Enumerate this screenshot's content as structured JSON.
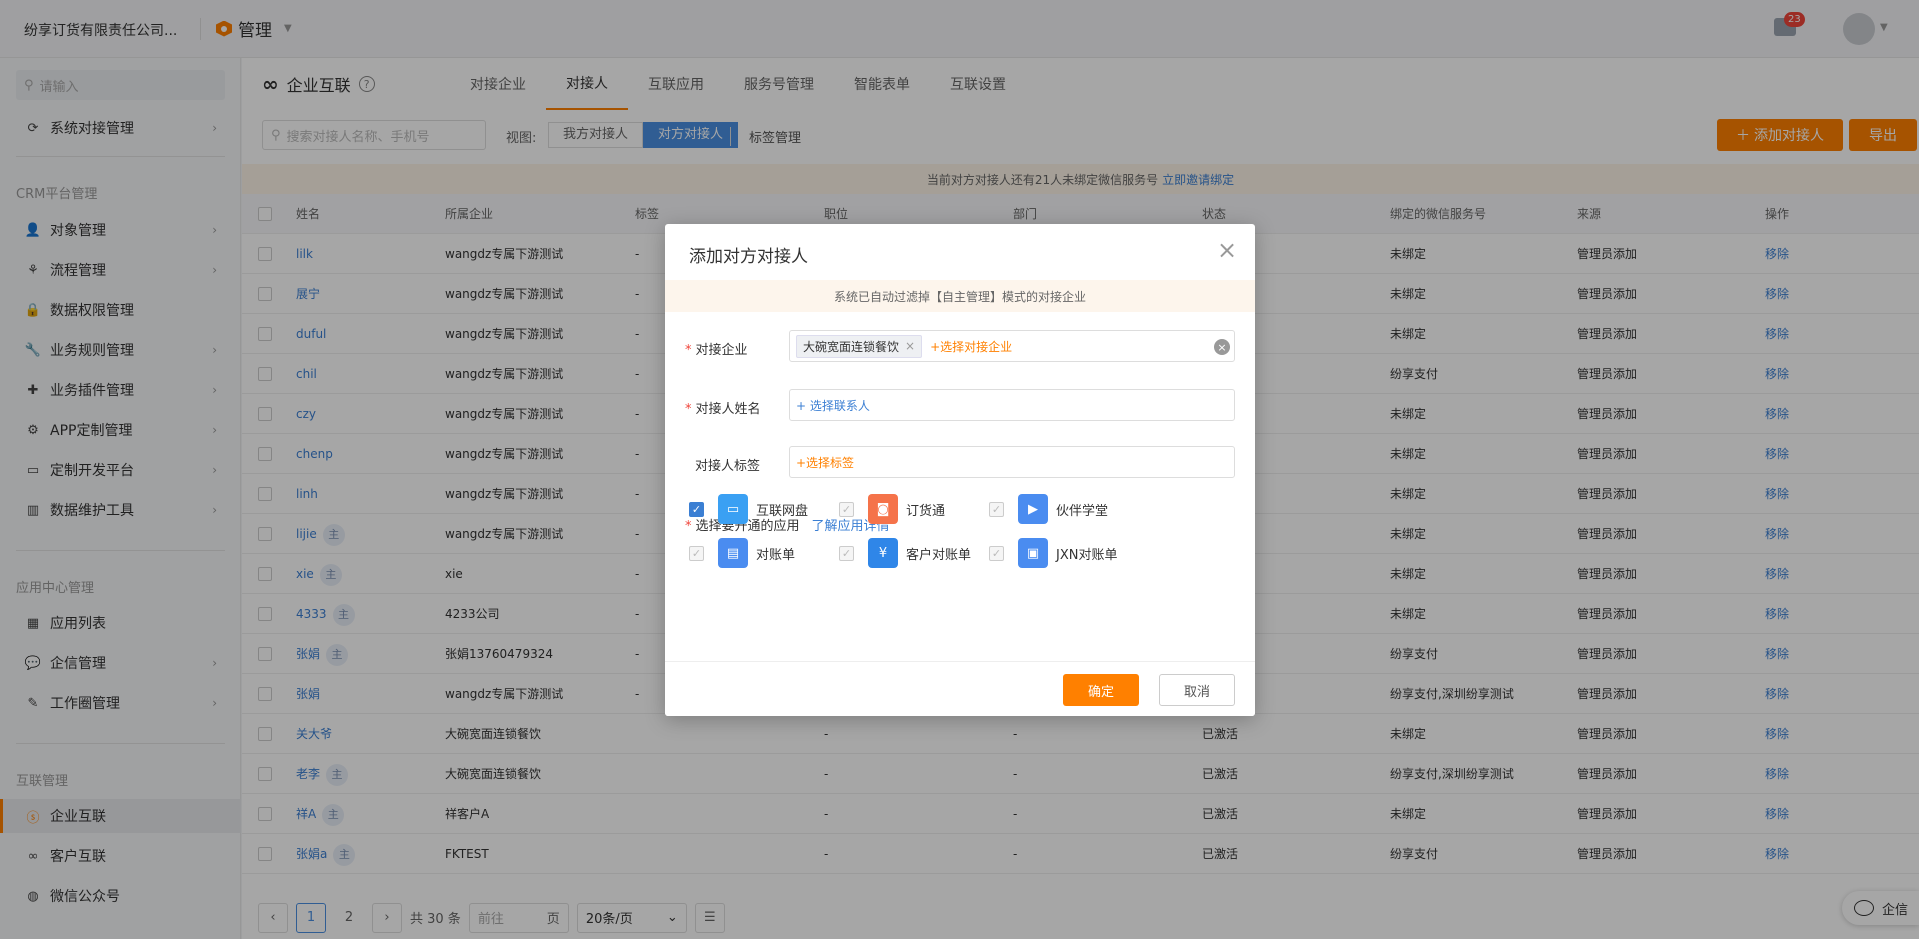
{
  "topbar": {
    "company": "纷享订货有限责任公司...",
    "module": "管理",
    "mail_count": "23"
  },
  "sidebar": {
    "search_placeholder": "请输入",
    "top_item": "系统对接管理",
    "groups": [
      "CRM平台管理",
      "应用中心管理",
      "互联管理"
    ],
    "crm_items": [
      "对象管理",
      "流程管理",
      "数据权限管理",
      "业务规则管理",
      "业务插件管理",
      "APP定制管理",
      "定制开发平台",
      "数据维护工具"
    ],
    "app_items": [
      "应用列表",
      "企信管理",
      "工作圈管理"
    ],
    "link_items": [
      "企业互联",
      "客户互联",
      "微信公众号"
    ]
  },
  "main": {
    "title": "企业互联",
    "tabs": [
      "对接企业",
      "对接人",
      "互联应用",
      "服务号管理",
      "智能表单",
      "互联设置"
    ],
    "search_placeholder": "搜索对接人名称、手机号",
    "view_label": "视图:",
    "view_options": [
      "我方对接人",
      "对方对接人"
    ],
    "tag_mgmt": "标签管理",
    "add_button": "添加对接人",
    "export_button": "导出",
    "notice_text": "当前对方对接人还有21人未绑定微信服务号",
    "notice_link": "立即邀请绑定"
  },
  "table": {
    "headers": [
      "姓名",
      "所属企业",
      "标签",
      "职位",
      "部门",
      "状态",
      "绑定的微信服务号",
      "来源",
      "操作"
    ],
    "rows": [
      {
        "name": "lilk",
        "master": false,
        "company": "wangdz专属下游测试",
        "tag": "-",
        "position": "",
        "dept": "",
        "status": "",
        "wechat": "未绑定",
        "source": "管理员添加",
        "action": "移除"
      },
      {
        "name": "展宁",
        "master": false,
        "company": "wangdz专属下游测试",
        "tag": "-",
        "position": "",
        "dept": "",
        "status": "",
        "wechat": "未绑定",
        "source": "管理员添加",
        "action": "移除"
      },
      {
        "name": "duful",
        "master": false,
        "company": "wangdz专属下游测试",
        "tag": "-",
        "position": "",
        "dept": "",
        "status": "",
        "wechat": "未绑定",
        "source": "管理员添加",
        "action": "移除"
      },
      {
        "name": "chil",
        "master": false,
        "company": "wangdz专属下游测试",
        "tag": "-",
        "position": "",
        "dept": "",
        "status": "",
        "wechat": "纷享支付",
        "source": "管理员添加",
        "action": "移除"
      },
      {
        "name": "czy",
        "master": false,
        "company": "wangdz专属下游测试",
        "tag": "-",
        "position": "",
        "dept": "",
        "status": "",
        "wechat": "未绑定",
        "source": "管理员添加",
        "action": "移除"
      },
      {
        "name": "chenp",
        "master": false,
        "company": "wangdz专属下游测试",
        "tag": "-",
        "position": "",
        "dept": "",
        "status": "",
        "wechat": "未绑定",
        "source": "管理员添加",
        "action": "移除"
      },
      {
        "name": "linh",
        "master": false,
        "company": "wangdz专属下游测试",
        "tag": "-",
        "position": "",
        "dept": "",
        "status": "",
        "wechat": "未绑定",
        "source": "管理员添加",
        "action": "移除"
      },
      {
        "name": "lijie",
        "master": true,
        "company": "wangdz专属下游测试",
        "tag": "-",
        "position": "",
        "dept": "",
        "status": "",
        "wechat": "未绑定",
        "source": "管理员添加",
        "action": "移除"
      },
      {
        "name": "xie",
        "master": true,
        "company": "xie",
        "tag": "-",
        "position": "",
        "dept": "",
        "status": "",
        "wechat": "未绑定",
        "source": "管理员添加",
        "action": "移除"
      },
      {
        "name": "4333",
        "master": true,
        "company": "4233公司",
        "tag": "-",
        "position": "",
        "dept": "",
        "status": "",
        "wechat": "未绑定",
        "source": "管理员添加",
        "action": "移除"
      },
      {
        "name": "张娟",
        "master": true,
        "company": "张娟13760479324",
        "tag": "-",
        "position": "",
        "dept": "",
        "status": "",
        "wechat": "纷享支付",
        "source": "管理员添加",
        "action": "移除"
      },
      {
        "name": "张娟",
        "master": false,
        "company": "wangdz专属下游测试",
        "tag": "-",
        "position": "",
        "dept": "",
        "status": "",
        "wechat": "纷享支付,深圳纷享测试",
        "source": "管理员添加",
        "action": "移除"
      },
      {
        "name": "关大爷",
        "master": false,
        "company": "大碗宽面连锁餐饮",
        "tag": "",
        "position": "-",
        "dept": "-",
        "status": "已激活",
        "wechat": "未绑定",
        "source": "管理员添加",
        "action": "移除"
      },
      {
        "name": "老李",
        "master": true,
        "company": "大碗宽面连锁餐饮",
        "tag": "",
        "position": "-",
        "dept": "-",
        "status": "已激活",
        "wechat": "纷享支付,深圳纷享测试",
        "source": "管理员添加",
        "action": "移除"
      },
      {
        "name": "祥A",
        "master": true,
        "company": "祥客户A",
        "tag": "",
        "position": "-",
        "dept": "-",
        "status": "已激活",
        "wechat": "未绑定",
        "source": "管理员添加",
        "action": "移除"
      },
      {
        "name": "张娟a",
        "master": true,
        "company": "FKTEST",
        "tag": "",
        "position": "-",
        "dept": "-",
        "status": "已激活",
        "wechat": "纷享支付",
        "source": "管理员添加",
        "action": "移除"
      }
    ],
    "master_label": "主"
  },
  "pager": {
    "pages": [
      "1",
      "2"
    ],
    "total": "共 30 条",
    "goto_placeholder": "前往",
    "goto_unit": "页",
    "page_size": "20条/页"
  },
  "qixin": "企信",
  "modal": {
    "title": "添加对方对接人",
    "tip": "系统已自动过滤掉【自主管理】模式的对接企业",
    "field_company_label": "对接企业",
    "company_chip": "大碗宽面连锁餐饮",
    "company_add": "+选择对接企业",
    "field_name_label": "对接人姓名",
    "name_add": "+ 选择联系人",
    "field_tag_label": "对接人标签",
    "tag_add": "+选择标签",
    "apps_label": "选择要开通的应用",
    "apps_link": "了解应用详情",
    "apps": [
      {
        "name": "互联网盘",
        "checked": true,
        "color": "#3aa0f3",
        "icon": "drive-icon"
      },
      {
        "name": "订货通",
        "checked": true,
        "color": "#f5734a",
        "icon": "order-icon"
      },
      {
        "name": "伙伴学堂",
        "checked": true,
        "color": "#4a8cf0",
        "icon": "school-icon"
      },
      {
        "name": "对账单",
        "checked": true,
        "color": "#4a8cf0",
        "icon": "statement-icon"
      },
      {
        "name": "客户对账单",
        "checked": true,
        "color": "#2f86e8",
        "icon": "customer-statement-icon"
      },
      {
        "name": "JXN对账单",
        "checked": true,
        "color": "#4a8cf0",
        "icon": "jxn-statement-icon"
      }
    ],
    "ok": "确定",
    "cancel": "取消"
  }
}
